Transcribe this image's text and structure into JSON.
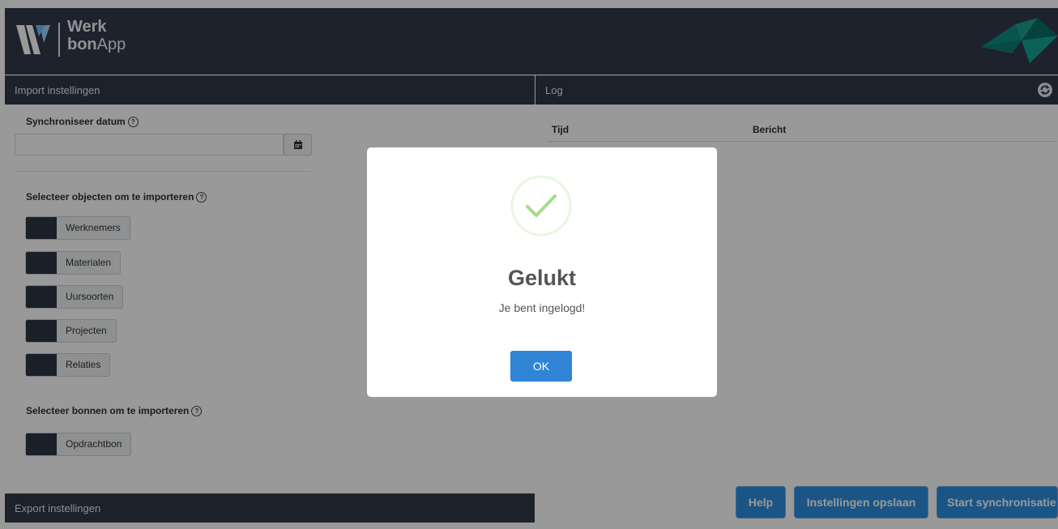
{
  "header": {
    "logo_word1": "Werk",
    "logo_word2_bold": "bon",
    "logo_word2_rest": "App"
  },
  "import_section": {
    "title": "Import instellingen",
    "sync_date_label": "Synchroniseer datum",
    "sync_date_value": "",
    "select_objects_label": "Selecteer objecten om te importeren",
    "objects": [
      "Werknemers",
      "Materialen",
      "Uursoorten",
      "Projecten",
      "Relaties"
    ],
    "select_vouchers_label": "Selecteer bonnen om te importeren",
    "vouchers": [
      "Opdrachtbon"
    ]
  },
  "export_section": {
    "title": "Export instellingen"
  },
  "log_section": {
    "title": "Log",
    "columns": [
      "Tijd",
      "Bericht"
    ]
  },
  "buttons": {
    "help": "Help",
    "save": "Instellingen opslaan",
    "sync": "Start synchronisatie"
  },
  "dialog": {
    "title": "Gelukt",
    "message": "Je bent ingelogd!",
    "ok": "OK"
  },
  "help_glyph": "?",
  "colors": {
    "header_bg": "#333a4a",
    "primary_button": "#2e8ede",
    "success_green": "#a5dc86",
    "toggle_dark": "#2c3443"
  }
}
